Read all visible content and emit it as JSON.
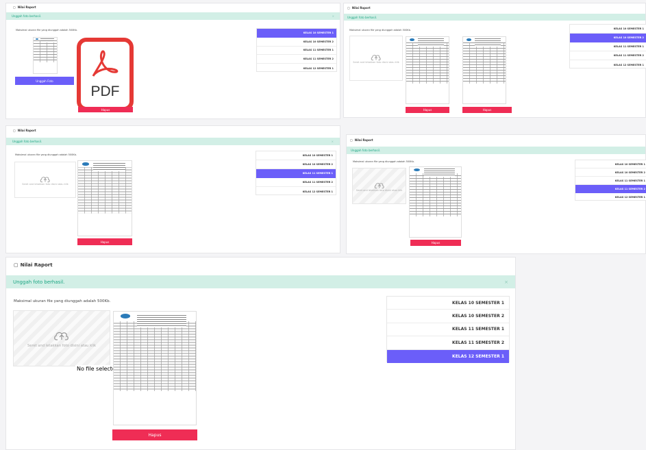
{
  "page_title": "Nilai Raport",
  "success_msg": "Unggah foto berhasil.",
  "close_icon": "×",
  "max_text": "Maksimal ukuran file yang diunggah adalah 500Kb.",
  "drop_text": "Seret and letakkan foto disini atau klik",
  "no_file": "No file selected.",
  "delete_label": "Hapus",
  "upload_label": "Unggah Foto",
  "pdf_label": "PDF",
  "semesters": [
    "KELAS 10 SEMESTER 1",
    "KELAS 10 SEMESTER 2",
    "KELAS 11 SEMESTER 1",
    "KELAS 11 SEMESTER 2",
    "KELAS 12 SEMESTER 1"
  ],
  "colors": {
    "accent": "#6b5ef9",
    "danger": "#ef2d55",
    "success_bg": "#d2efe6",
    "success_text": "#1aa582",
    "pdf_red": "#e53935"
  },
  "icons": {
    "title": "book-icon",
    "upload": "cloud-upload-icon",
    "close": "close-icon",
    "pdf": "pdf-file-icon"
  }
}
